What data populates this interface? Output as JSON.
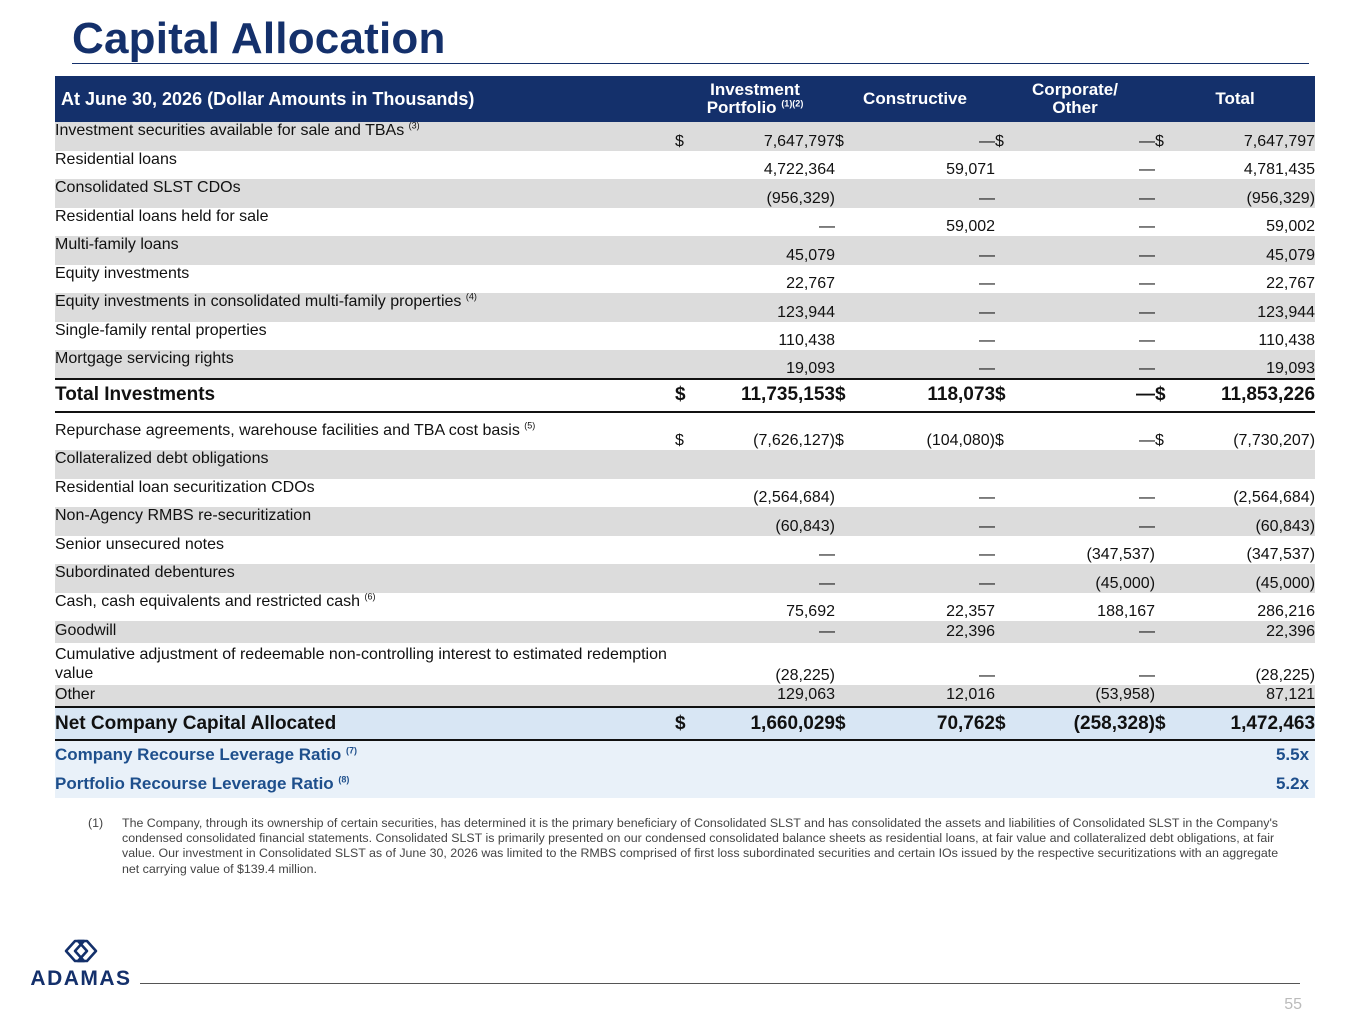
{
  "page": {
    "title": "Capital Allocation",
    "page_number": "55",
    "logo_text": "ADAMAS",
    "footnote_marker": "(1)",
    "footnote_text": "The Company, through its ownership of certain securities, has determined it is the primary beneficiary of Consolidated SLST and has consolidated the assets and liabilities of Consolidated SLST in the Company's condensed consolidated financial statements. Consolidated SLST is primarily presented on our condensed consolidated balance sheets as residential loans, at fair value and collateralized debt obligations, at fair value. Our investment in Consolidated SLST as of June 30, 2026 was limited to the RMBS comprised of first loss subordinated securities and certain IOs issued by the respective securitizations with an aggregate net carrying value of $139.4 million."
  },
  "table": {
    "header": {
      "label": "At June 30, 2026 (Dollar Amounts in Thousands)",
      "col1_line1": "Investment",
      "col1_line2": "Portfolio",
      "col1_sup": "(1)(2)",
      "col2": "Constructive",
      "col3_line1": "Corporate/",
      "col3_line2": "Other",
      "col4": "Total"
    },
    "rows": [
      {
        "label": "Investment securities available for sale and TBAs",
        "sup": "(3)",
        "c1": "$",
        "v1": "7,647,797",
        "c2": "$",
        "v2": "—",
        "c3": "$",
        "v3": "—",
        "c4": "$",
        "v4": "7,647,797"
      },
      {
        "label": "Residential loans",
        "sup": "",
        "c1": "",
        "v1": "4,722,364",
        "c2": "",
        "v2": "59,071",
        "c3": "",
        "v3": "—",
        "c4": "",
        "v4": "4,781,435"
      },
      {
        "label": "Consolidated SLST CDOs",
        "sup": "",
        "c1": "",
        "v1": "(956,329)",
        "c2": "",
        "v2": "—",
        "c3": "",
        "v3": "—",
        "c4": "",
        "v4": "(956,329)"
      },
      {
        "label": "Residential loans held for sale",
        "sup": "",
        "c1": "",
        "v1": "—",
        "c2": "",
        "v2": "59,002",
        "c3": "",
        "v3": "—",
        "c4": "",
        "v4": "59,002"
      },
      {
        "label": "Multi-family loans",
        "sup": "",
        "c1": "",
        "v1": "45,079",
        "c2": "",
        "v2": "—",
        "c3": "",
        "v3": "—",
        "c4": "",
        "v4": "45,079"
      },
      {
        "label": "Equity investments",
        "sup": "",
        "c1": "",
        "v1": "22,767",
        "c2": "",
        "v2": "—",
        "c3": "",
        "v3": "—",
        "c4": "",
        "v4": "22,767"
      },
      {
        "label": "Equity investments in consolidated multi-family properties",
        "sup": "(4)",
        "c1": "",
        "v1": "123,944",
        "c2": "",
        "v2": "—",
        "c3": "",
        "v3": "—",
        "c4": "",
        "v4": "123,944"
      },
      {
        "label": "Single-family rental properties",
        "sup": "",
        "c1": "",
        "v1": "110,438",
        "c2": "",
        "v2": "—",
        "c3": "",
        "v3": "—",
        "c4": "",
        "v4": "110,438"
      },
      {
        "label": "Mortgage servicing rights",
        "sup": "",
        "c1": "",
        "v1": "19,093",
        "c2": "",
        "v2": "—",
        "c3": "",
        "v3": "—",
        "c4": "",
        "v4": "19,093"
      }
    ],
    "total_investments": {
      "label": "Total Investments",
      "c1": "$",
      "v1": "11,735,153",
      "c2": "$",
      "v2": "118,073",
      "c3": "$",
      "v3": "—",
      "c4": "$",
      "v4": "11,853,226"
    },
    "rows2": [
      {
        "label": "Repurchase agreements, warehouse facilities and TBA cost basis",
        "sup": "(5)",
        "c1": "$",
        "v1": "(7,626,127)",
        "c2": "$",
        "v2": "(104,080)",
        "c3": "$",
        "v3": "—",
        "c4": "$",
        "v4": "(7,730,207)"
      },
      {
        "label": "Collateralized debt obligations",
        "sup": "",
        "c1": "",
        "v1": "",
        "c2": "",
        "v2": "",
        "c3": "",
        "v3": "",
        "c4": "",
        "v4": ""
      },
      {
        "label": "Residential loan securitization CDOs",
        "sup": "",
        "c1": "",
        "v1": "(2,564,684)",
        "c2": "",
        "v2": "—",
        "c3": "",
        "v3": "—",
        "c4": "",
        "v4": "(2,564,684)"
      },
      {
        "label": "Non-Agency RMBS re-securitization",
        "sup": "",
        "c1": "",
        "v1": "(60,843)",
        "c2": "",
        "v2": "—",
        "c3": "",
        "v3": "—",
        "c4": "",
        "v4": "(60,843)"
      },
      {
        "label": "Senior unsecured notes",
        "sup": "",
        "c1": "",
        "v1": "—",
        "c2": "",
        "v2": "—",
        "c3": "",
        "v3": "(347,537)",
        "c4": "",
        "v4": "(347,537)"
      },
      {
        "label": "Subordinated debentures",
        "sup": "",
        "c1": "",
        "v1": "—",
        "c2": "",
        "v2": "—",
        "c3": "",
        "v3": "(45,000)",
        "c4": "",
        "v4": "(45,000)"
      },
      {
        "label": "Cash, cash equivalents and restricted cash",
        "sup": "(6)",
        "c1": "",
        "v1": "75,692",
        "c2": "",
        "v2": "22,357",
        "c3": "",
        "v3": "188,167",
        "c4": "",
        "v4": "286,216"
      },
      {
        "label": "Goodwill",
        "sup": "",
        "c1": "",
        "v1": "—",
        "c2": "",
        "v2": "22,396",
        "c3": "",
        "v3": "—",
        "c4": "",
        "v4": "22,396"
      },
      {
        "label": "Cumulative adjustment of redeemable non-controlling interest to estimated redemption value",
        "sup": "",
        "c1": "",
        "v1": "(28,225)",
        "c2": "",
        "v2": "—",
        "c3": "",
        "v3": "—",
        "c4": "",
        "v4": "(28,225)"
      },
      {
        "label": "Other",
        "sup": "",
        "c1": "",
        "v1": "129,063",
        "c2": "",
        "v2": "12,016",
        "c3": "",
        "v3": "(53,958)",
        "c4": "",
        "v4": "87,121"
      }
    ],
    "net_capital": {
      "label": "Net Company Capital Allocated",
      "c1": "$",
      "v1": "1,660,029",
      "c2": "$",
      "v2": "70,762",
      "c3": "$",
      "v3": "(258,328)",
      "c4": "$",
      "v4": "1,472,463"
    },
    "ratios": [
      {
        "label": "Company Recourse Leverage Ratio",
        "sup": "(7)",
        "value": "5.5x"
      },
      {
        "label": "Portfolio Recourse Leverage Ratio",
        "sup": "(8)",
        "value": "5.2x"
      }
    ]
  }
}
